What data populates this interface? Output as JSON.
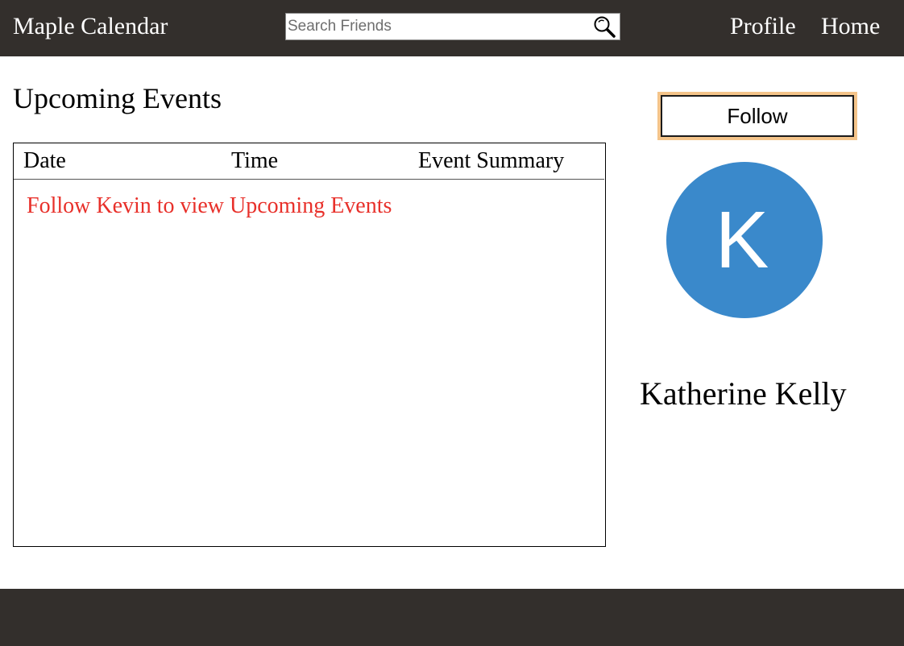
{
  "header": {
    "brand": "Maple Calendar",
    "search_placeholder": "Search Friends",
    "search_icon": "search-icon",
    "nav": {
      "profile": "Profile",
      "home": "Home"
    }
  },
  "events": {
    "title": "Upcoming Events",
    "columns": [
      "Date",
      "Time",
      "Event Summary"
    ],
    "empty_message": "Follow Kevin to view Upcoming Events"
  },
  "profile": {
    "follow_label": "Follow",
    "avatar_letter": "K",
    "name": "Katherine Kelly"
  },
  "colors": {
    "header_bg": "#332f2c",
    "avatar_bg": "#3a89cb",
    "message_red": "#e8302a",
    "follow_focus": "#f4c48a"
  }
}
